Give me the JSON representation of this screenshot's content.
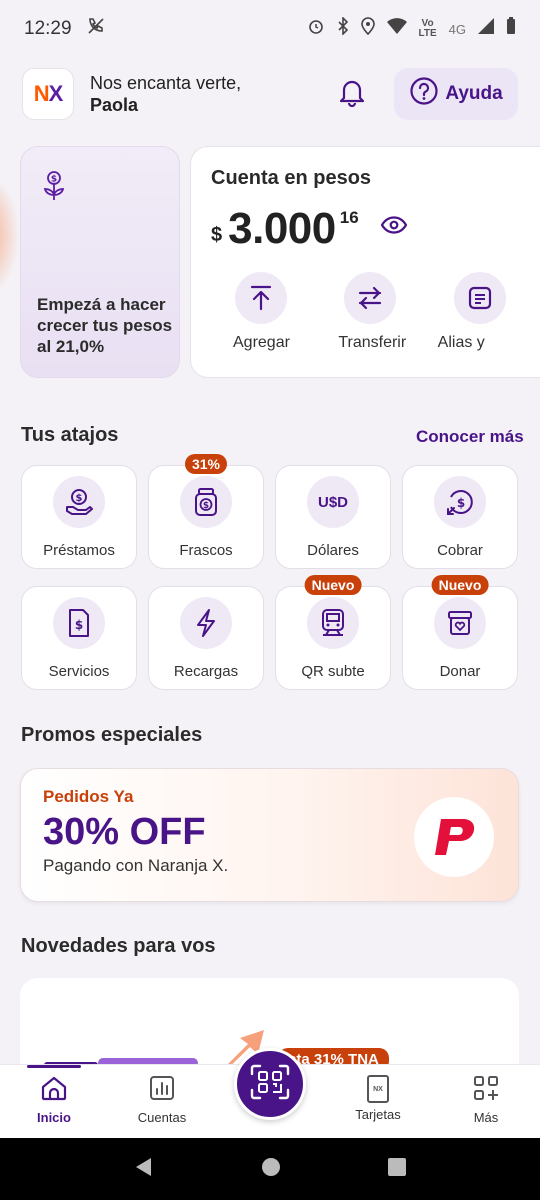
{
  "status_bar": {
    "time": "12:29",
    "network_top": "Vo",
    "network_bottom": "LTE",
    "network_type": "4G"
  },
  "header": {
    "logo_n": "N",
    "logo_x": "X",
    "greeting_line1": "Nos encanta verte,",
    "greeting_name": "Paola",
    "help_label": "Ayuda"
  },
  "promo_card": {
    "text": "Empezá a hacer crecer tus pesos al 21,0%"
  },
  "account": {
    "title": "Cuenta en pesos",
    "currency": "$",
    "amount": "3.000",
    "cents": "16",
    "actions": [
      {
        "label": "Agregar",
        "icon": "upload-arrow-icon"
      },
      {
        "label": "Transferir",
        "icon": "transfer-arrows-icon"
      },
      {
        "label": "Alias y",
        "icon": "document-list-icon"
      }
    ]
  },
  "shortcuts": {
    "title": "Tus atajos",
    "more_link": "Conocer más",
    "items": [
      {
        "label": "Préstamos",
        "icon": "loan-hand-icon",
        "badge": ""
      },
      {
        "label": "Frascos",
        "icon": "jar-icon",
        "badge": "31%"
      },
      {
        "label": "Dólares",
        "icon": "usd-icon",
        "badge": ""
      },
      {
        "label": "Cobrar",
        "icon": "collect-money-icon",
        "badge": ""
      },
      {
        "label": "Servicios",
        "icon": "bill-icon",
        "badge": ""
      },
      {
        "label": "Recargas",
        "icon": "lightning-icon",
        "badge": ""
      },
      {
        "label": "QR subte",
        "icon": "subway-icon",
        "badge": "Nuevo"
      },
      {
        "label": "Donar",
        "icon": "donate-box-icon",
        "badge": "Nuevo"
      }
    ],
    "usd_text": "U$D"
  },
  "promos": {
    "title": "Promos especiales",
    "brand": "Pedidos Ya",
    "offer": "30% OFF",
    "subtitle": "Pagando con Naranja X."
  },
  "news": {
    "title": "Novedades para vos",
    "tag": "sta 31% TNA"
  },
  "bottom_nav": {
    "items": [
      {
        "label": "Inicio",
        "icon": "home-icon"
      },
      {
        "label": "Cuentas",
        "icon": "chart-bars-icon"
      },
      {
        "label": "Tarjetas",
        "icon": "card-icon"
      },
      {
        "label": "Más",
        "icon": "grid-plus-icon"
      }
    ],
    "card_icon_text": "NX"
  },
  "colors": {
    "primary": "#4a1489",
    "accent": "#fe5a00",
    "badge": "#c8400a"
  }
}
